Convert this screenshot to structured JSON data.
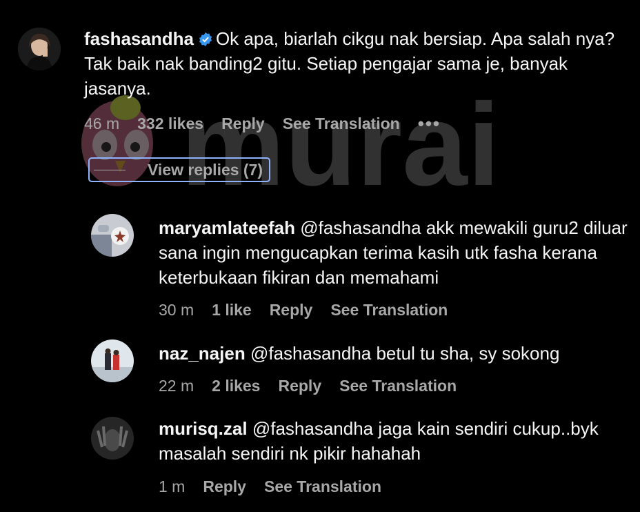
{
  "watermark": {
    "text": "murai",
    "color": "#5a5a5a"
  },
  "main_comment": {
    "username": "fashasandha",
    "verified": true,
    "text": "Ok apa, biarlah cikgu nak bersiap. Apa salah nya? Tak baik nak banding2 gitu. Setiap pengajar sama je, banyak jasanya.",
    "time": "46 m",
    "likes": "332 likes",
    "reply": "Reply",
    "see_translation": "See Translation",
    "more": "•••",
    "view_replies": "View replies (7)"
  },
  "replies": [
    {
      "username": "maryamlateefah",
      "text": "@fashasandha akk mewakili guru2 diluar sana ingin mengucapkan terima kasih utk fasha kerana keterbukaan fikiran dan memahami",
      "time": "30 m",
      "likes": "1 like",
      "reply": "Reply",
      "see_translation": "See Translation"
    },
    {
      "username": "naz_najen",
      "text": "@fashasandha betul tu sha, sy sokong",
      "time": "22 m",
      "likes": "2 likes",
      "reply": "Reply",
      "see_translation": "See Translation"
    },
    {
      "username": "murisq.zal",
      "text": "@fashasandha jaga kain sendiri cukup..byk masalah sendiri nk pikir hahahah",
      "time": "1 m",
      "reply": "Reply",
      "see_translation": "See Translation"
    }
  ],
  "colors": {
    "background": "#000000",
    "text": "#f5f5f5",
    "meta": "#a8a8a8",
    "verified": "#3897f0",
    "focus_ring": "#8fb3ff"
  }
}
